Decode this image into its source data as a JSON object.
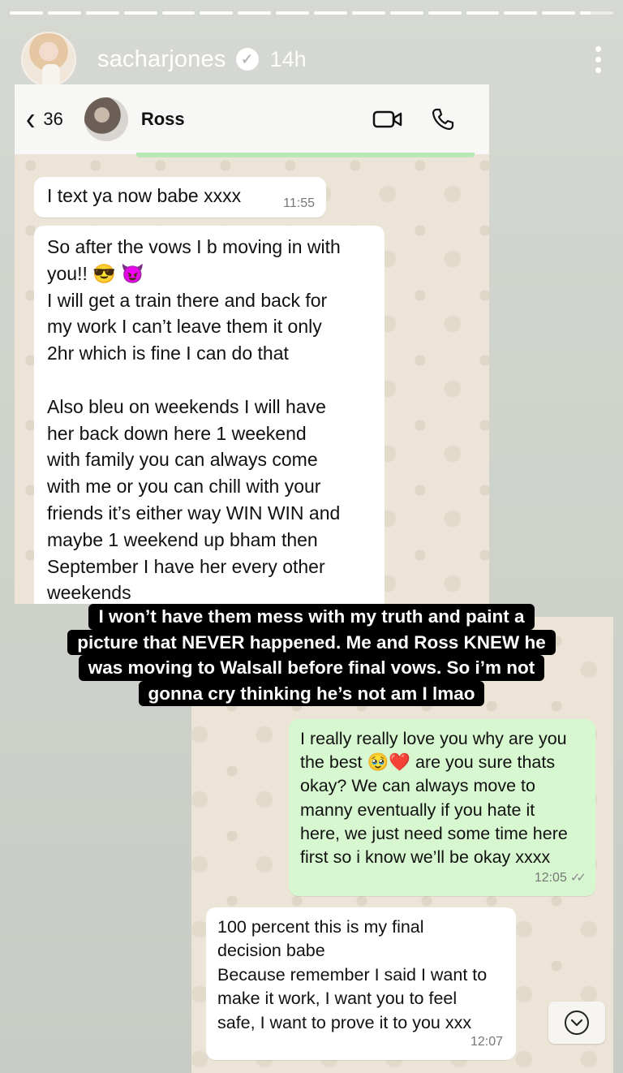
{
  "story": {
    "username": "sacharjones",
    "time_ago": "14h",
    "segments": 16,
    "current_progress_fraction": 0.3
  },
  "chat1": {
    "back_count": "36",
    "contact_name": "Ross",
    "messages": [
      {
        "text": "I text ya now babe xxxx",
        "time": "11:55"
      },
      {
        "text": "So after the vows I b moving in with\nyou!! 😎 😈\nI will get a train there and back for\nmy work I can’t leave them it only\n2hr which is fine I can do that\n\nAlso bleu on weekends I will have\nher back down here 1 weekend\nwith family you can always come\nwith me or you can chill with your\nfriends it’s either way WIN WIN and\nmaybe 1 weekend up bham then\nSeptember I have her every other\nweekends"
      }
    ]
  },
  "caption": {
    "lines": [
      "I won’t have them mess with my truth and paint a",
      "picture that NEVER happened. Me and Ross KNEW he",
      "was moving to Walsall before final vows. So i’m not",
      "gonna cry thinking he’s not am I lmao"
    ]
  },
  "chat2": {
    "sent": {
      "text": "I really really love you why are you\nthe best 🥹❤️ are you sure thats\nokay? We can always move to\nmanny eventually if you hate it\nhere, we just need some time here\nfirst so i know we’ll be okay xxxx",
      "time": "12:05"
    },
    "received": {
      "text": "100 percent this is my final\ndecision babe\nBecause remember I said I want to\nmake it work, I want you to feel\nsafe, I want to prove it to you xxx",
      "time": "12:07"
    }
  },
  "icons": {
    "verified": "verified-badge-icon",
    "menu": "more-vertical-icon",
    "back": "chevron-left-icon",
    "video": "video-call-icon",
    "phone": "phone-icon",
    "scroll": "chevron-down-circle-icon"
  },
  "colors": {
    "sent_bubble": "#d6f7cf",
    "received_bubble": "#ffffff",
    "caption_bg": "#000000"
  }
}
